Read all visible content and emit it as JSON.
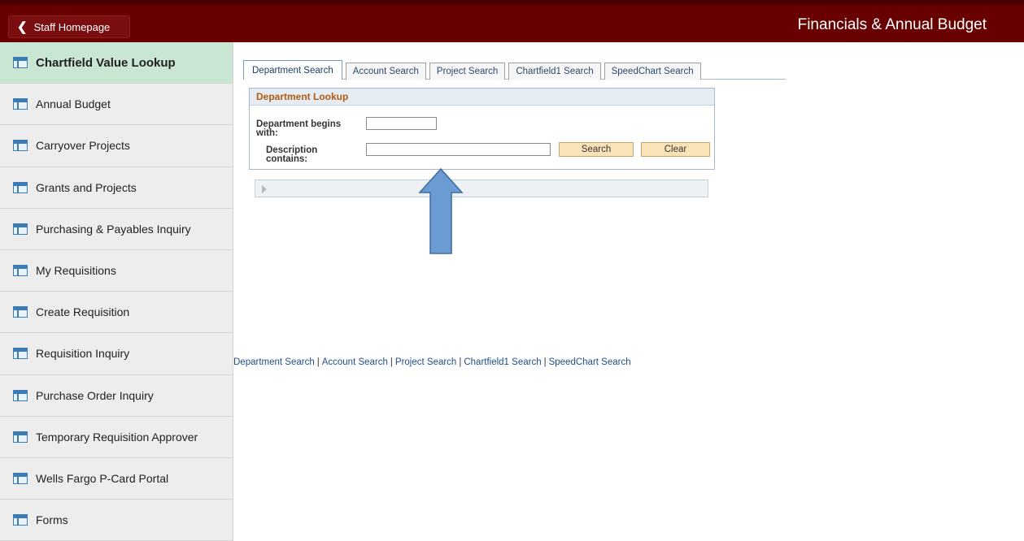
{
  "header": {
    "back_label": "Staff Homepage",
    "title": "Financials & Annual Budget"
  },
  "sidebar": {
    "items": [
      {
        "label": "Chartfield Value Lookup",
        "icon": "tile-icon",
        "active": true
      },
      {
        "label": "Annual Budget",
        "icon": "tile-icon"
      },
      {
        "label": "Carryover Projects",
        "icon": "tile-icon"
      },
      {
        "label": "Grants and Projects",
        "icon": "tile-icon"
      },
      {
        "label": "Purchasing & Payables Inquiry",
        "icon": "tile-icon"
      },
      {
        "label": "My Requisitions",
        "icon": "tile-icon"
      },
      {
        "label": "Create Requisition",
        "icon": "tile-icon"
      },
      {
        "label": "Requisition Inquiry",
        "icon": "tile-icon"
      },
      {
        "label": "Purchase Order Inquiry",
        "icon": "tile-icon"
      },
      {
        "label": "Temporary Requisition Approver",
        "icon": "tile-icon"
      },
      {
        "label": "Wells Fargo P-Card Portal",
        "icon": "tile-icon"
      },
      {
        "label": "Forms",
        "icon": "tile-icon"
      }
    ]
  },
  "tabs": [
    {
      "label": "Department Search",
      "active": true
    },
    {
      "label": "Account Search"
    },
    {
      "label": "Project Search"
    },
    {
      "label": "Chartfield1 Search"
    },
    {
      "label": "SpeedChart Search"
    }
  ],
  "lookup": {
    "title": "Department Lookup",
    "dept_label_line1": "Department begins",
    "dept_label_line2": "with:",
    "dept_value": "",
    "desc_label_line1": "Description",
    "desc_label_line2": "contains:",
    "desc_value": "",
    "search_label": "Search",
    "clear_label": "Clear"
  },
  "bottom_links": {
    "items": [
      "Department Search",
      "Account Search",
      "Project Search",
      "Chartfield1 Search",
      "SpeedChart Search"
    ],
    "separator": "|"
  },
  "colors": {
    "header_bg": "#680000",
    "active_nav_bg": "#c8e6d2",
    "annotation_arrow": "#6b9bd2",
    "button_bg": "#fbe3b8",
    "panel_title": "#b35a10",
    "link": "#1f4f8a"
  }
}
